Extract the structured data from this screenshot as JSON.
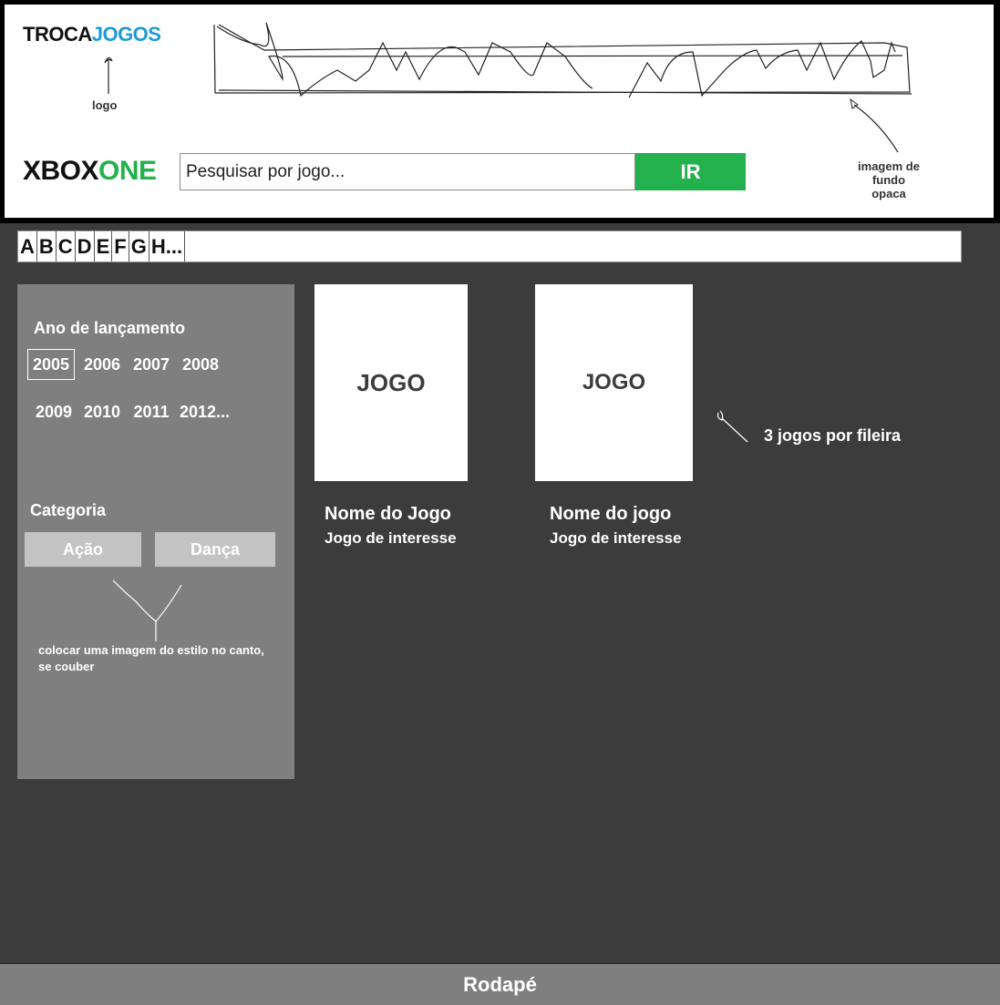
{
  "header": {
    "logo_part1": "TROCA",
    "logo_part2": "JOGOS",
    "logo_note": "logo",
    "platform_part1": "XBOX",
    "platform_part2": "ONE",
    "search_placeholder": "Pesquisar por jogo...",
    "search_button": "IR",
    "background_note_line1": "imagem de fundo",
    "background_note_line2": "opaca"
  },
  "alphabet": [
    "A",
    "B",
    "C",
    "D",
    "E",
    "F",
    "G",
    "H..."
  ],
  "sidebar": {
    "release_year_title": "Ano de lançamento",
    "years_row1": [
      "2005",
      "2006",
      "2007",
      "2008"
    ],
    "years_row2": [
      "2009",
      "2010",
      "2011",
      "2012..."
    ],
    "selected_year": "2005",
    "category_title": "Categoria",
    "categories": [
      "Ação",
      "Dança"
    ],
    "note_line1": "colocar uma imagem do estilo no canto,",
    "note_line2": "se couber"
  },
  "games": [
    {
      "image_label": "JOGO",
      "name": "Nome do Jogo",
      "subtitle": "Jogo de interesse"
    },
    {
      "image_label": "JOGO",
      "name": "Nome do jogo",
      "subtitle": "Jogo de interesse"
    }
  ],
  "annotation_per_row": "3 jogos por fileira",
  "footer": {
    "label": "Rodapé"
  },
  "colors": {
    "blue_accent": "#1e9ad6",
    "green_accent": "#22b14c",
    "background": "#3c3c3c",
    "panel": "#7f7f7f"
  }
}
